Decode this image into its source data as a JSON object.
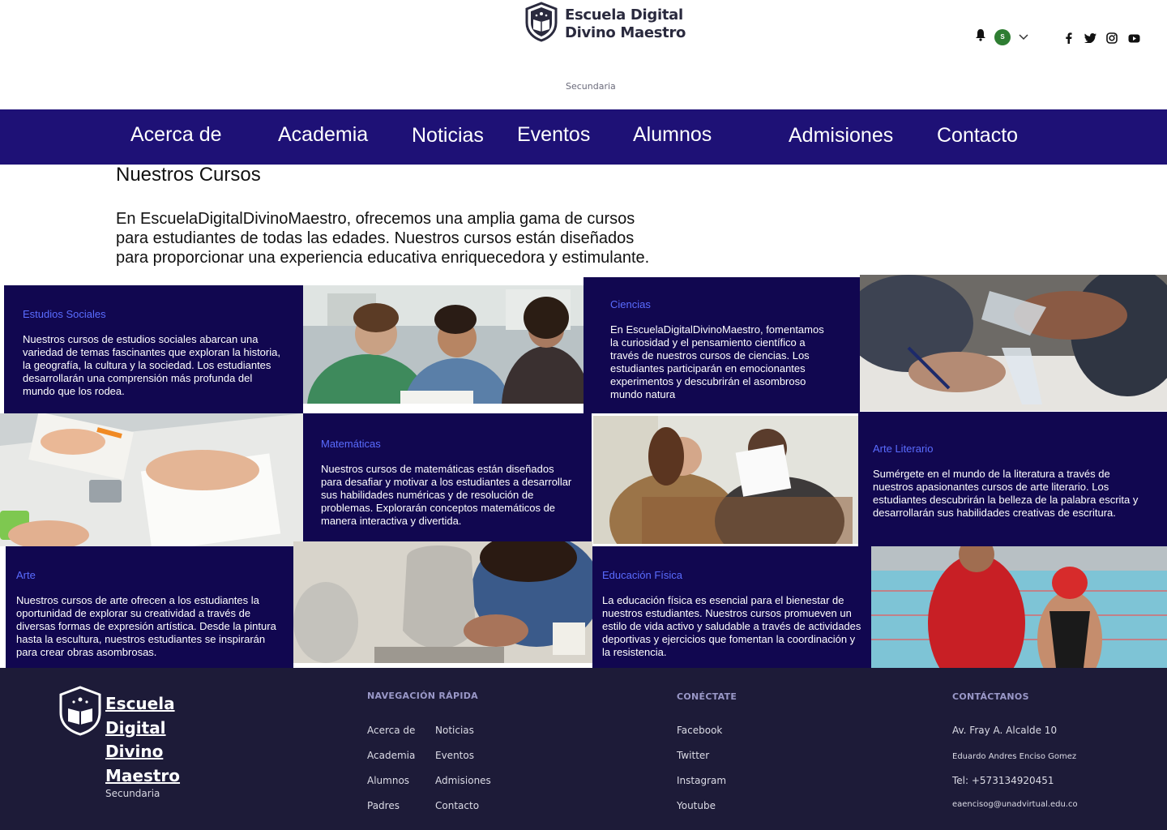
{
  "header": {
    "brand_line1": "Escuela Digital",
    "brand_line2": "Divino Maestro",
    "subtitle": "Secundaria",
    "avatar_initial": "S",
    "icons": [
      "bell-icon",
      "chevron-down-icon",
      "facebook-icon",
      "twitter-icon",
      "instagram-icon",
      "youtube-icon"
    ]
  },
  "nav": {
    "items": [
      "Acerca de",
      "Academia",
      "Noticias",
      "Eventos",
      "Alumnos",
      "Admisiones",
      "Contacto"
    ]
  },
  "main": {
    "title": "Nuestros Cursos",
    "intro": "En EscuelaDigitalDivinoMaestro, ofrecemos una amplia gama de cursos para estudiantes de todas las edades. Nuestros cursos están diseñados para proporcionar una experiencia educativa enriquecedora y estimulante."
  },
  "courses": [
    {
      "title": "Estudios Sociales",
      "text": "Nuestros cursos de estudios sociales abarcan una variedad de temas fascinantes que exploran la historia, la geografía, la cultura y la sociedad. Los estudiantes desarrollarán una comprensión más profunda del mundo que los rodea."
    },
    {
      "title": "Ciencias",
      "text": "En EscuelaDigitalDivinoMaestro, fomentamos la curiosidad y el pensamiento científico a través de nuestros cursos de ciencias. Los estudiantes participarán en emocionantes experimentos y descubrirán el asombroso mundo natura"
    },
    {
      "title": "Matemáticas",
      "text": "Nuestros cursos de matemáticas están diseñados para desafiar y motivar a los estudiantes a desarrollar sus habilidades numéricas y de resolución de problemas. Explorarán conceptos matemáticos de manera interactiva y divertida."
    },
    {
      "title": "Arte Literario",
      "text": "Sumérgete en el mundo de la literatura a través de nuestros apasionantes cursos de arte literario. Los estudiantes descubrirán la belleza de la palabra escrita y desarrollarán sus habilidades creativas de escritura."
    },
    {
      "title": "Arte",
      "text": "Nuestros cursos de arte ofrecen a los estudiantes la oportunidad de explorar su creatividad a través de diversas formas de expresión artística. Desde la pintura hasta la escultura, nuestros estudiantes se inspirarán para crear obras asombrosas."
    },
    {
      "title": "Educación Física",
      "text": "La educación física es esencial para el bienestar de nuestros estudiantes. Nuestros cursos promueven un estilo de vida activo y saludable a través de actividades deportivas y ejercicios que fomentan la coordinación y la resistencia."
    }
  ],
  "footer": {
    "brand_lines": [
      "Escuela",
      "Digital",
      "Divino",
      "Maestro"
    ],
    "subtitle": "Secundaria",
    "quick_nav_title": "NAVEGACIÓN RÁPIDA",
    "quick_nav_col1": [
      "Acerca de",
      "Academia",
      "Alumnos",
      "Padres"
    ],
    "quick_nav_col2": [
      "Noticias",
      "Eventos",
      "Admisiones",
      "Contacto"
    ],
    "connect_title": "CONÉCTATE",
    "connect_links": [
      "Facebook",
      "Twitter",
      "Instagram",
      "Youtube"
    ],
    "contact_title": "CONTÁCTANOS",
    "address": "Av. Fray A. Alcalde 10",
    "person": "Eduardo Andres Enciso Gomez",
    "phone": "Tel: +573134920451",
    "email": "eaencisog@unadvirtual.edu.co"
  },
  "colors": {
    "nav_bg": "#1e1176",
    "card_bg": "#110750",
    "card_title": "#5a6cff",
    "footer_bg": "#1d1b38"
  }
}
